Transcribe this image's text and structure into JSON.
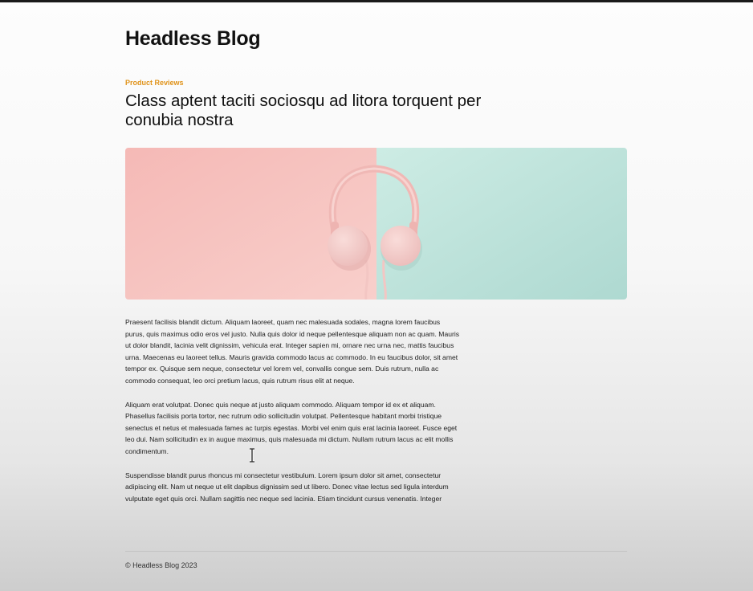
{
  "site": {
    "title": "Headless Blog"
  },
  "post": {
    "category": "Product Reviews",
    "title": "Class aptent taciti sociosqu ad litora torquent per conubia nostra",
    "paragraphs": [
      "Praesent facilisis blandit dictum. Aliquam laoreet, quam nec malesuada sodales, magna lorem faucibus\npurus, quis maximus odio eros vel justo. Nulla quis dolor id neque pellentesque aliquam non ac quam. Mauris\nut dolor blandit, lacinia velit dignissim, vehicula erat. Integer sapien mi, ornare nec urna nec, mattis faucibus\nurna. Maecenas eu laoreet tellus. Mauris gravida commodo lacus ac commodo. In eu faucibus dolor, sit amet\ntempor ex. Quisque sem neque, consectetur vel lorem vel, convallis congue sem. Duis rutrum, nulla ac\ncommodo consequat, leo orci pretium lacus, quis rutrum risus elit at neque.",
      "Aliquam erat volutpat. Donec quis neque at justo aliquam commodo. Aliquam tempor id ex et aliquam.\nPhasellus facilisis porta tortor, nec rutrum odio sollicitudin volutpat. Pellentesque habitant morbi tristique\nsenectus et netus et malesuada fames ac turpis egestas. Morbi vel enim quis erat lacinia laoreet. Fusce eget\nleo dui. Nam sollicitudin ex in augue maximus, quis malesuada mi dictum. Nullam rutrum lacus ac elit mollis\ncondimentum.",
      "Suspendisse blandit purus rhoncus mi consectetur vestibulum. Lorem ipsum dolor sit amet, consectetur\nadipiscing elit. Nam ut neque ut elit dapibus dignissim sed ut libero. Donec vitae lectus sed ligula interdum\nvulputate eget quis orci. Nullam sagittis nec neque sed lacinia. Etiam tincidunt cursus venenatis. Integer"
    ]
  },
  "hero_image": {
    "subject": "pink-headphones-on-split-pink-and-mint-background",
    "colors": {
      "left_background": "#f5c0bd",
      "right_background": "#bfe6dd",
      "headphones": "#f1c4c4"
    }
  },
  "footer": {
    "copyright": "© Headless Blog 2023"
  },
  "colors": {
    "category_accent": "#e0931a",
    "text": "#1b1b1b"
  }
}
